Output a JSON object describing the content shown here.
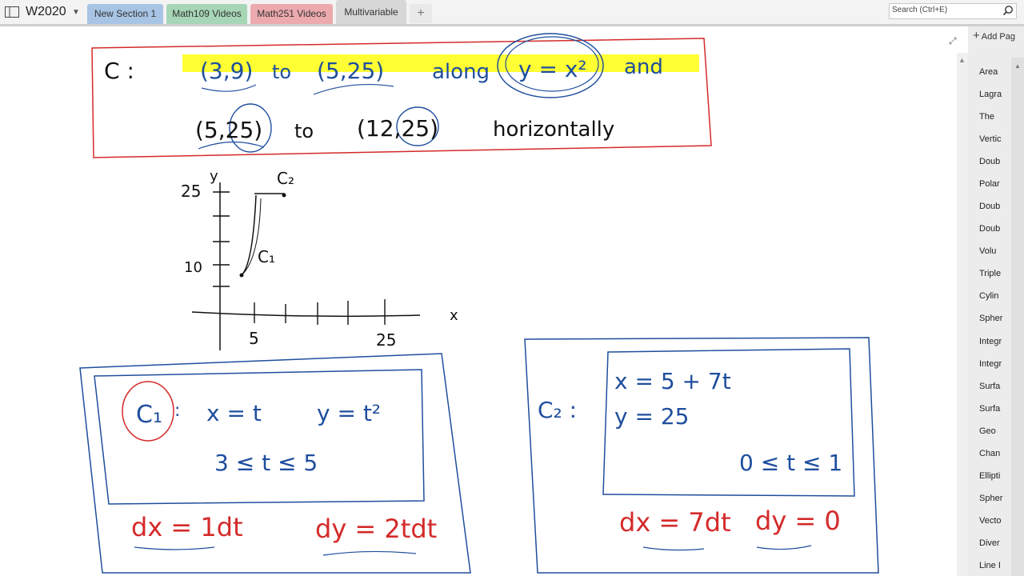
{
  "notebook": {
    "title": "W2020"
  },
  "tabs": [
    {
      "label": "New Section 1",
      "color": "#a8c4e5"
    },
    {
      "label": "Math109 Videos",
      "color": "#a6d6b6"
    },
    {
      "label": "Math251 Videos",
      "color": "#eca9ae"
    },
    {
      "label": "Multivariable",
      "color": "#d7d7d7"
    }
  ],
  "add_tab": "+",
  "search": {
    "placeholder": "Search (Ctrl+E)"
  },
  "pages": {
    "add_label": "Add Pag",
    "items": [
      "Area",
      "Lagra",
      "The",
      "Vertic",
      "Doub",
      "Polar",
      "Doub",
      "Doub",
      "Volu",
      "Triple",
      "Cylin",
      "Spher",
      "Integr",
      "Integr",
      "Surfa",
      "Surfa",
      "Geo",
      "Chan",
      "Ellipti",
      "Spher",
      "Vecto",
      "Diver",
      "Line I"
    ]
  },
  "ink": {
    "curve_label": "C :",
    "point_a": "(3,9)",
    "to1": "to",
    "point_b": "(5,25)",
    "along": "along",
    "equation": "y = x²",
    "and": "and",
    "point_c": "(5,25)",
    "to2": "to",
    "point_d": "(12,25)",
    "horizontally": "horizontally",
    "graph_y": "y",
    "graph_x": "x",
    "tick_25_y": "25",
    "tick_10_y": "10",
    "tick_5_x": "5",
    "tick_25_x": "25",
    "label_c2": "C₂",
    "label_c1": "C₁",
    "c1_name": "C₁",
    "c1_colon": ":",
    "c1_x": "x = t",
    "c1_y": "y = t²",
    "c1_range": "3 ≤ t ≤ 5",
    "c1_dx": "dx = 1dt",
    "c1_dy": "dy = 2tdt",
    "c2_name": "C₂ :",
    "c2_x": "x = 5 + 7t",
    "c2_y": "y = 25",
    "c2_range": "0 ≤ t ≤ 1",
    "c2_dx": "dx = 7dt",
    "c2_dy": "dy = 0"
  },
  "colors": {
    "ink_blue": "#1f4e9e",
    "ink_red": "#d42a2a",
    "ink_black": "#111111",
    "highlight": "#ffff33"
  }
}
